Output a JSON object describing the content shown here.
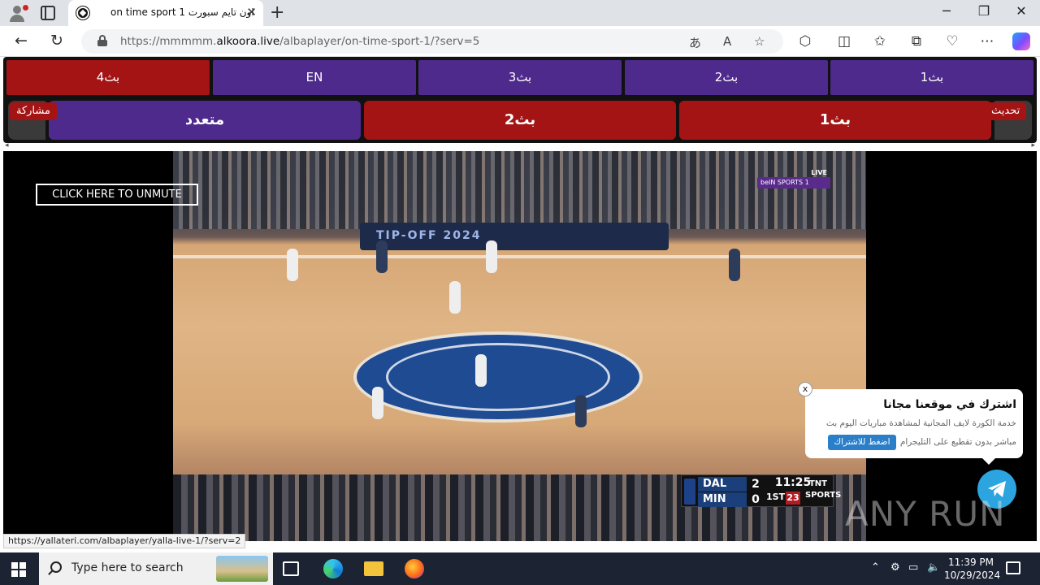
{
  "browser": {
    "tab_title": "on time sport 1 اون تايم سبورت",
    "url_prefix": "https://mmmmm.",
    "url_host": "alkoora.live",
    "url_path": "/albaplayer/on-time-sport-1/?serv=5",
    "status_url": "https://yallateri.com/albaplayer/yalla-live-1/?serv=2"
  },
  "servers_row1": [
    {
      "label": "بث4",
      "active": true
    },
    {
      "label": "EN",
      "active": false
    },
    {
      "label": "بث3",
      "active": false
    },
    {
      "label": "بث2",
      "active": false
    },
    {
      "label": "بث1",
      "active": false
    }
  ],
  "servers_row2": [
    {
      "label": "متعدد"
    },
    {
      "label": "بث2"
    },
    {
      "label": "بث1"
    }
  ],
  "tags": {
    "share": "مشاركة",
    "refresh": "تحديث"
  },
  "player": {
    "unmute_label": "CLICK HERE TO UNMUTE",
    "bein_live": "LIVE",
    "bein_logo": "beIN SPORTS 1",
    "banner_text": "TIP-OFF 2024",
    "score": {
      "team1": "DAL",
      "score1": "2",
      "team2": "MIN",
      "score2": "0",
      "clock": "11:25",
      "quarter": "1ST",
      "shot_clock": "23",
      "network": "TNT SPORTS"
    }
  },
  "popup": {
    "heading": "اشترك في موقعنا مجانا",
    "line1": "خدمة الكورة لايف المجانية لمشاهدة مباريات اليوم بث",
    "line2": "مباشر بدون تقطيع على التليجرام",
    "button": "اضغط للاشتراك",
    "close": "x"
  },
  "watermark": "ANY RUN",
  "taskbar": {
    "search_placeholder": "Type here to search",
    "time": "11:39 PM",
    "date": "10/29/2024"
  },
  "colors": {
    "purple": "#4e2a8c",
    "red": "#a41414",
    "telegram": "#2ca4e0"
  }
}
